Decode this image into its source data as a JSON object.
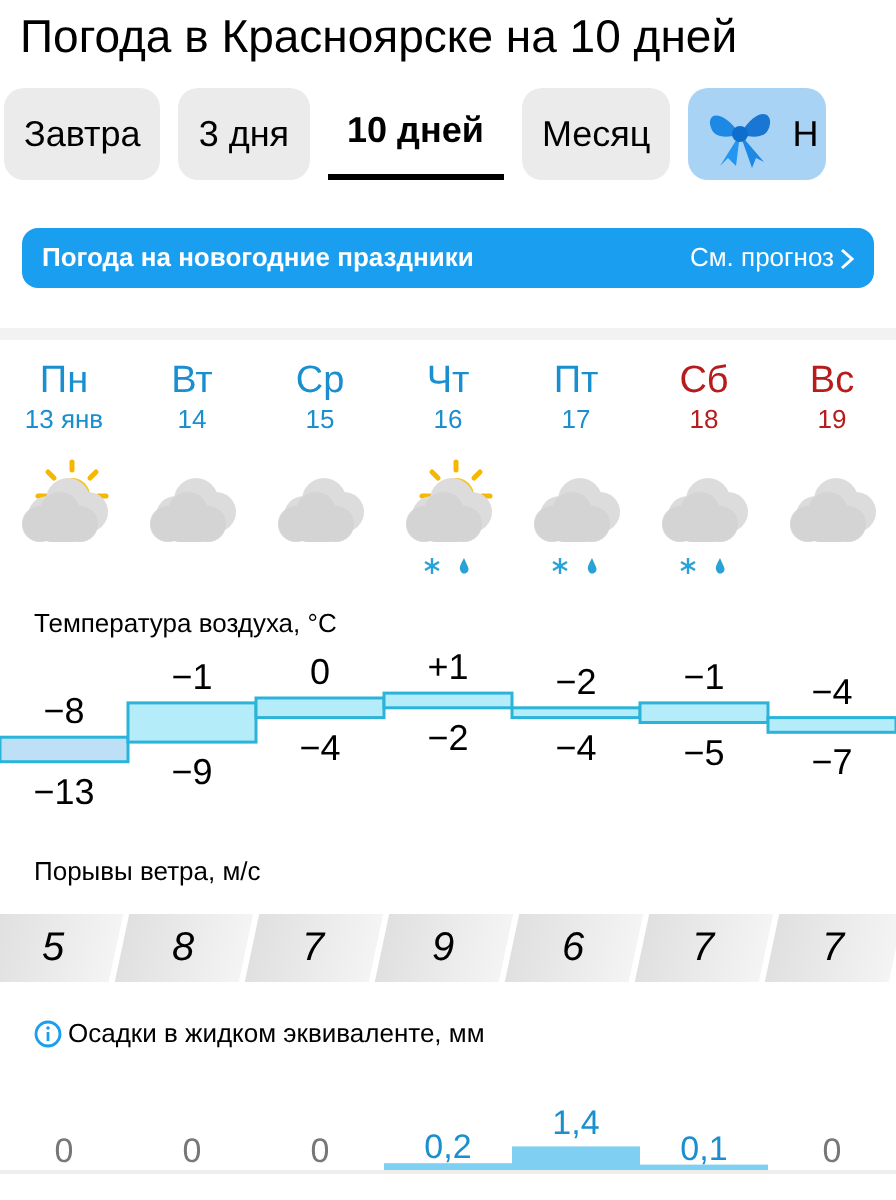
{
  "title": "Погода в Красноярске на 10 дней",
  "tabs": [
    {
      "label": "Завтра",
      "selected": false,
      "kind": "text"
    },
    {
      "label": "3 дня",
      "selected": false,
      "kind": "text"
    },
    {
      "label": "10 дней",
      "selected": true,
      "kind": "text"
    },
    {
      "label": "Месяц",
      "selected": false,
      "kind": "text"
    },
    {
      "label": "Н",
      "selected": false,
      "kind": "gift"
    }
  ],
  "banner": {
    "text": "Погода на новогодние праздники",
    "link": "См. прогноз"
  },
  "days": [
    {
      "weekday": "Пн",
      "date": "13 янв",
      "weekend": false,
      "kind": "sun-cloud",
      "precip": false,
      "max": "−8",
      "min": "−13",
      "wind": "5",
      "rain": "0"
    },
    {
      "weekday": "Вт",
      "date": "14",
      "weekend": false,
      "kind": "cloud",
      "precip": false,
      "max": "−1",
      "min": "−9",
      "wind": "8",
      "rain": "0"
    },
    {
      "weekday": "Ср",
      "date": "15",
      "weekend": false,
      "kind": "cloud",
      "precip": false,
      "max": "0",
      "min": "−4",
      "wind": "7",
      "rain": "0"
    },
    {
      "weekday": "Чт",
      "date": "16",
      "weekend": false,
      "kind": "sun-cloud",
      "precip": true,
      "max": "+1",
      "min": "−2",
      "wind": "9",
      "rain": "0,2"
    },
    {
      "weekday": "Пт",
      "date": "17",
      "weekend": false,
      "kind": "cloud",
      "precip": true,
      "max": "−2",
      "min": "−4",
      "wind": "6",
      "rain": "1,4"
    },
    {
      "weekday": "Сб",
      "date": "18",
      "weekend": true,
      "kind": "cloud",
      "precip": true,
      "max": "−1",
      "min": "−5",
      "wind": "7",
      "rain": "0,1"
    },
    {
      "weekday": "Вс",
      "date": "19",
      "weekend": true,
      "kind": "cloud",
      "precip": false,
      "max": "−4",
      "min": "−7",
      "wind": "7",
      "rain": "0"
    }
  ],
  "temperature_label": "Температура воздуха, °C",
  "wind_label": "Порывы ветра, м/с",
  "precip_label": "Осадки в жидком эквиваленте, мм"
}
